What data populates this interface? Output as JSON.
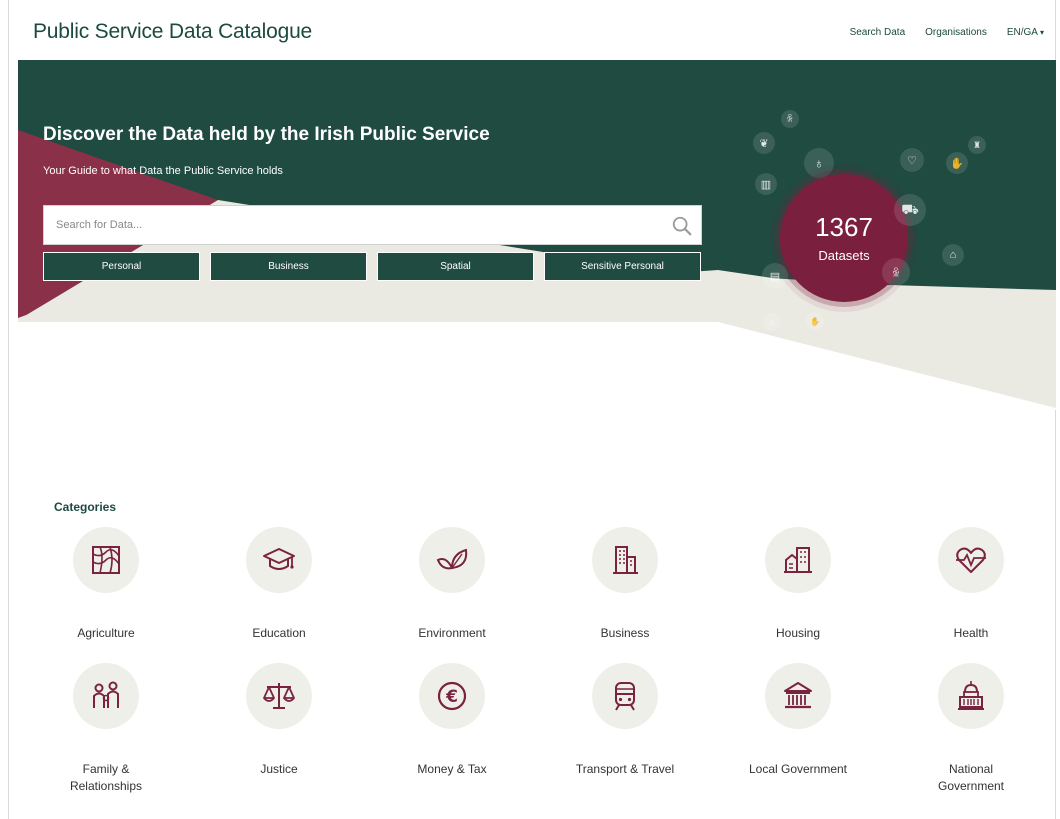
{
  "header": {
    "title": "Public Service Data Catalogue",
    "nav": {
      "search_data": "Search Data",
      "organisations": "Organisations",
      "language": "EN/GA"
    }
  },
  "hero": {
    "title": "Discover the Data held by the Irish Public Service",
    "subtitle": "Your Guide to what Data the Public Service holds",
    "search_placeholder": "Search for Data...",
    "filters": [
      "Personal",
      "Business",
      "Spatial",
      "Sensitive Personal"
    ],
    "dataset_count": "1367",
    "dataset_label": "Datasets"
  },
  "categories": {
    "heading": "Categories",
    "row1": [
      "Agriculture",
      "Education",
      "Environment",
      "Business",
      "Housing",
      "Health"
    ],
    "row2": [
      "Family & Relationships",
      "Justice",
      "Money & Tax",
      "Transport & Travel",
      "Local Government",
      "National Government"
    ]
  },
  "colors": {
    "brand_green": "#1f4b41",
    "brand_maroon": "#7a1f3d",
    "cream": "#ebeae2",
    "icon_maroon": "#7a2340"
  }
}
